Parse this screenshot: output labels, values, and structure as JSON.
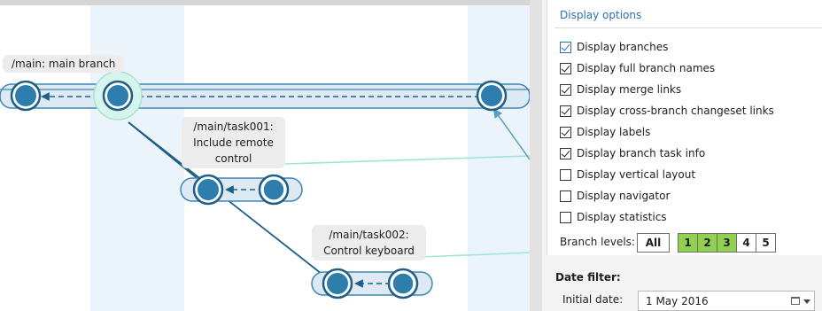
{
  "graph": {
    "labels": [
      {
        "lines": [
          "/main: main branch"
        ]
      },
      {
        "lines": [
          "/main/task001:",
          "Include remote",
          "control"
        ]
      },
      {
        "lines": [
          "/main/task002:",
          "Control keyboard"
        ]
      }
    ],
    "colors": {
      "node_fill": "#2e7ead",
      "node_ring": "#1f5f86",
      "branch_band": "#ddeaf4",
      "column_highlight": "#eaf4fa",
      "merge_link": "#8fe3cf"
    }
  },
  "options": {
    "title": "Display options",
    "items": [
      {
        "label": "Display branches",
        "checked": true
      },
      {
        "label": "Display full branch names",
        "checked": true
      },
      {
        "label": "Display merge links",
        "checked": true
      },
      {
        "label": "Display cross-branch changeset links",
        "checked": true
      },
      {
        "label": "Display labels",
        "checked": true
      },
      {
        "label": "Display branch task info",
        "checked": true
      },
      {
        "label": "Display vertical layout",
        "checked": false
      },
      {
        "label": "Display navigator",
        "checked": false
      },
      {
        "label": "Display statistics",
        "checked": false
      }
    ],
    "branch_levels": {
      "label": "Branch levels:",
      "buttons": [
        {
          "label": "All",
          "on": false
        },
        {
          "label": "1",
          "on": true
        },
        {
          "label": "2",
          "on": true
        },
        {
          "label": "3",
          "on": true
        },
        {
          "label": "4",
          "on": false
        },
        {
          "label": "5",
          "on": false
        }
      ],
      "active_color": "#92d050"
    }
  },
  "date_filter": {
    "title": "Date filter:",
    "initial_date_label": "Initial date:",
    "initial_date_value": "1 May 2016",
    "icon": "calendar-icon"
  }
}
